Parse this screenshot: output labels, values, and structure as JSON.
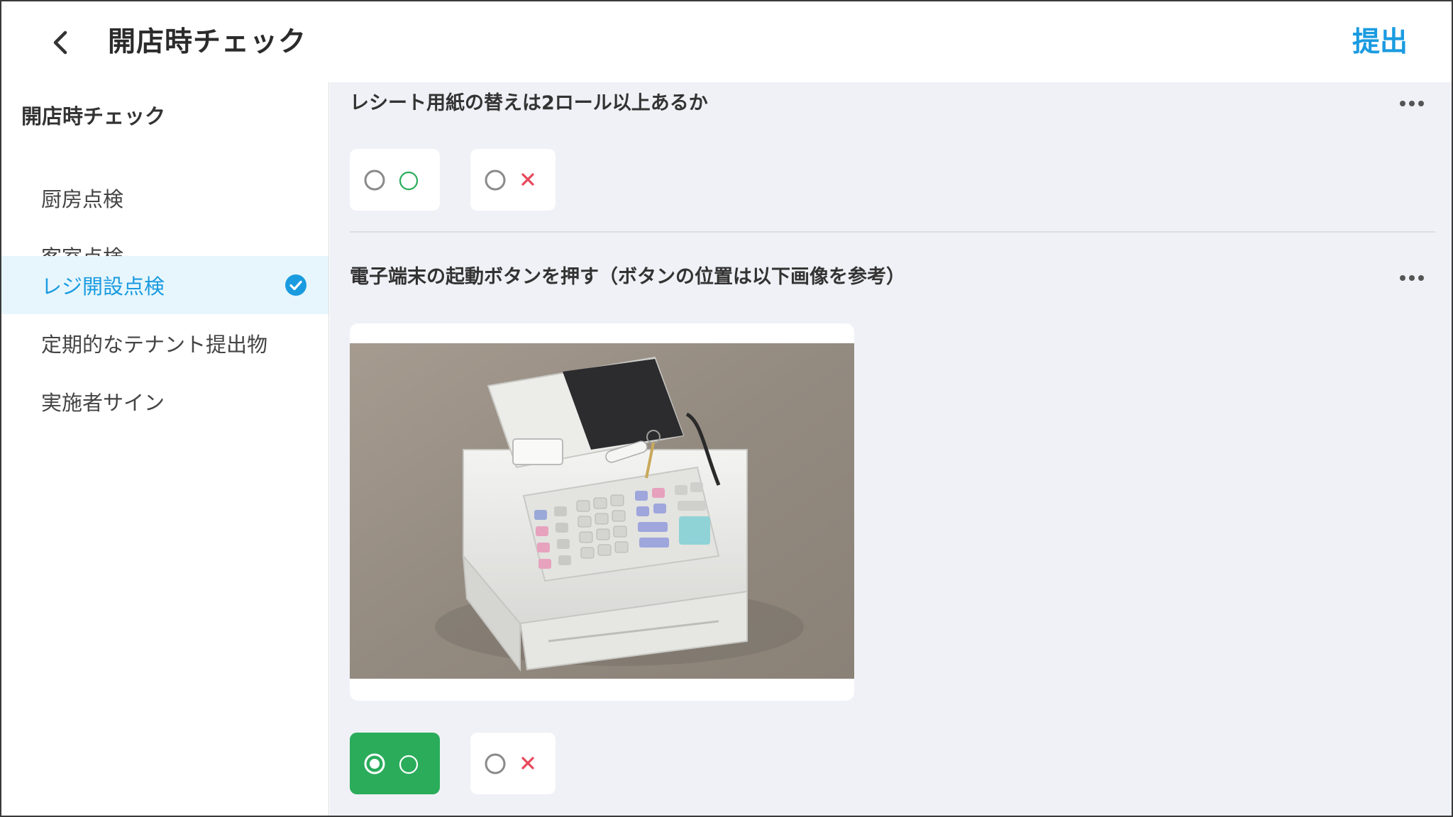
{
  "header": {
    "title": "開店時チェック",
    "submit_label": "提出"
  },
  "sidebar": {
    "heading": "開店時チェック",
    "items": [
      {
        "label": "厨房点検",
        "active": false
      },
      {
        "label": "客室点検",
        "active": false
      },
      {
        "label": "レジ開設点検",
        "active": true,
        "completed": true
      },
      {
        "label": "定期的なテナント提出物",
        "active": false
      },
      {
        "label": "実施者サイン",
        "active": false
      }
    ]
  },
  "questions": [
    {
      "title": "レシート用紙の替えは2ロール以上あるか",
      "options": [
        {
          "symbol": "circle",
          "selected": false
        },
        {
          "symbol": "cross",
          "selected": false
        }
      ]
    },
    {
      "title": "電子端末の起動ボタンを押す（ボタンの位置は以下画像を参考）",
      "image": "cash-register-photo",
      "options": [
        {
          "symbol": "circle",
          "selected": true
        },
        {
          "symbol": "cross",
          "selected": false
        }
      ]
    }
  ],
  "icons": {
    "back": "chevron-left-icon",
    "more": "more-horizontal-icon",
    "completed": "check-circle-icon"
  },
  "colors": {
    "accent": "#1a9be0",
    "active_bg": "#e7f6fc",
    "selected_option": "#2aac5b",
    "circle_mark": "#2aac5b",
    "cross_mark": "#e8485b",
    "content_bg": "#f0f1f6"
  }
}
